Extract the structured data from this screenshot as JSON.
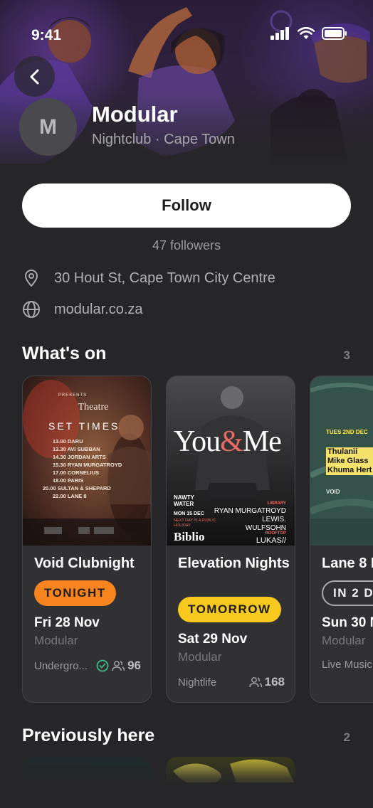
{
  "status_bar": {
    "time": "9:41"
  },
  "venue": {
    "avatar_initial": "M",
    "name": "Modular",
    "subtitle": "Nightclub · Cape Town",
    "follow_label": "Follow",
    "followers": "47 followers",
    "address": "30 Hout St, Cape Town City Centre",
    "website": "modular.co.za"
  },
  "whats_on": {
    "title": "What's on",
    "count": "3",
    "events": [
      {
        "title": "Void Clubnight",
        "badge": "TONIGHT",
        "date": "Fri 28 Nov",
        "venue": "Modular",
        "genre": "Undergro...",
        "attendees": "96",
        "poster": {
          "top": "PRESENTS",
          "header": "Theatre",
          "heading": "SET TIMES",
          "lineup": [
            "13.00 DARU",
            "13.30 AVI SUBBAN",
            "14.30 JORDAN ARTS",
            "15.30 RYAN MURGATROYD",
            "17.00 CORNELIUS",
            "18.00 PARIS",
            "20.00 SULTAN & SHEPARD",
            "22.00 LANE 8"
          ]
        }
      },
      {
        "title": "Elevation Nights",
        "badge": "TOMORROW",
        "date": "Sat 29 Nov",
        "venue": "Modular",
        "genre": "Nightlife",
        "attendees": "168",
        "poster": {
          "word1": "You",
          "amp": "&",
          "word2": "Me",
          "brand": "NAWTY WATER",
          "date": "MON 15 DEC",
          "note": "NEXT DAY IS A PUBLIC HOLIDAY",
          "venue": "Biblio",
          "label1": "LIBRARY",
          "lineup": [
            "RYAN MURGATROYD",
            "LEWIS.",
            "WULFSOHN"
          ],
          "label2": "ROOFTOP",
          "rooftop": "LUKAS//"
        }
      },
      {
        "title": "Lane 8 L",
        "badge": "IN 2 D",
        "date": "Sun 30 N",
        "venue": "Modular",
        "genre": "Live Music",
        "attendees": "",
        "poster": {
          "date": "TUES 2ND DEC",
          "lineup": [
            "Thulanii",
            "Mike Glass",
            "Khuma Hert"
          ],
          "logo": "VOID"
        }
      }
    ]
  },
  "previously_here": {
    "title": "Previously here",
    "count": "2"
  },
  "colors": {
    "background": "#262628",
    "card": "#313134",
    "tonight": "#f7841e",
    "tomorrow": "#f7c81e",
    "muted": "#77777c"
  }
}
